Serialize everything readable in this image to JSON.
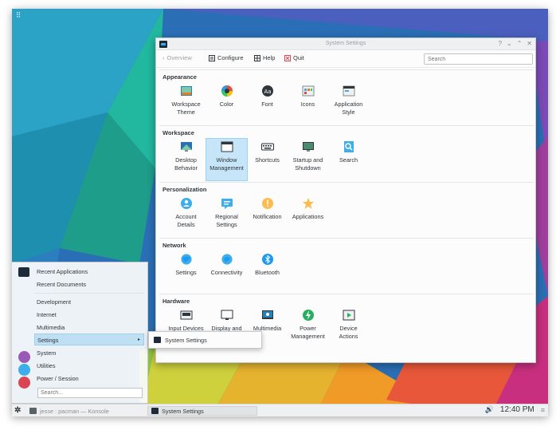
{
  "window": {
    "title": "System Settings",
    "controls": [
      "?",
      "⌄",
      "⌃",
      "✕"
    ]
  },
  "toolbar": {
    "overview": "Overview",
    "configure": "Configure",
    "help": "Help",
    "quit": "Quit",
    "search_placeholder": "Search"
  },
  "groups": [
    {
      "title": "Appearance",
      "items": [
        "Workspace\nTheme",
        "Color",
        "Font",
        "Icons",
        "Application\nStyle"
      ]
    },
    {
      "title": "Workspace",
      "items": [
        "Desktop\nBehavior",
        "Window\nManagement",
        "Shortcuts",
        "Startup and\nShutdown",
        "Search"
      ]
    },
    {
      "title": "Personalization",
      "items": [
        "Account\nDetails",
        "Regional\nSettings",
        "Notification",
        "Applications"
      ]
    },
    {
      "title": "Network",
      "items": [
        "Settings",
        "Connectivity",
        "Bluetooth"
      ]
    },
    {
      "title": "Hardware",
      "items": [
        "Input Devices",
        "Display and\nMonitor",
        "Multimedia",
        "Power\nManagement",
        "Device\nActions"
      ]
    }
  ],
  "menu": {
    "recent_applications": "Recent Applications",
    "recent_documents": "Recent Documents",
    "development": "Development",
    "internet": "Internet",
    "multimedia": "Multimedia",
    "settings": "Settings",
    "settings_arrow": "▸",
    "system": "System",
    "utilities": "Utilities",
    "power_session": "Power / Session",
    "search_placeholder": "Search..."
  },
  "submenu": {
    "system_settings": "System Settings"
  },
  "panel": {
    "launcher_icon": "kde-logo-icon",
    "task1": "jesse : pacman — Konsole",
    "task2": "System Settings",
    "clock": "12:40 PM",
    "volume_icon": "🔊",
    "menu_icon": "≡"
  },
  "colors": {
    "selection": "#c6e5f8",
    "accent": "#3daee9"
  }
}
